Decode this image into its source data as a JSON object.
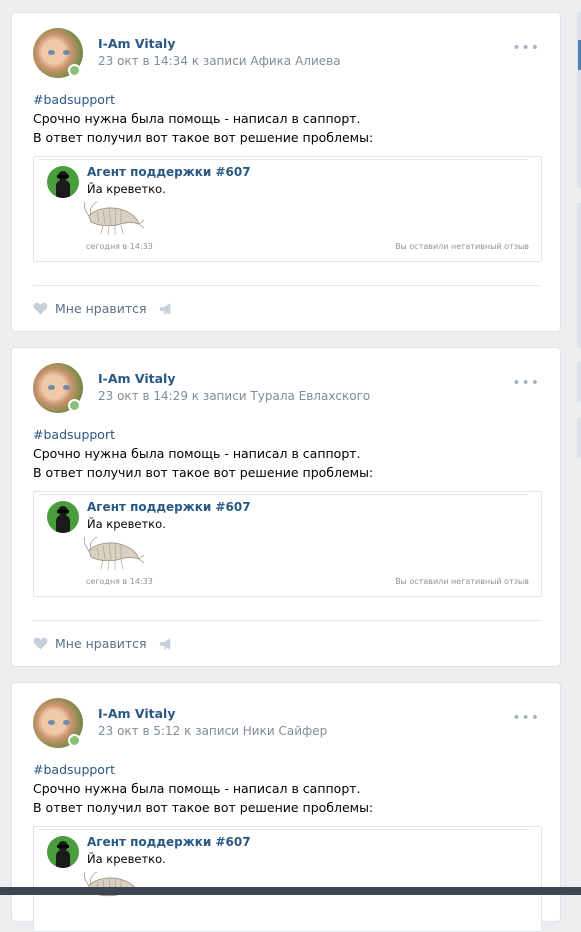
{
  "colors": {
    "link": "#2a5885",
    "meta": "#818c99",
    "online": "#8ac176",
    "agent_avatar_bg": "#4a9d3d",
    "page_bg": "#edeef0"
  },
  "posts": [
    {
      "author": "I-Am Vitaly",
      "date": "23 окт в 14:34 к записи Афика Алиева",
      "tag": "#badsupport",
      "line1": "Срочно нужна была помощь - написал в саппорт.",
      "line2": "В ответ получил вот такое вот решение проблемы:",
      "embed": {
        "agent": "Агент поддержки #607",
        "message": "Йа креветко.",
        "time": "сегодня в 14:33",
        "status": "Вы оставили негативный отзыв"
      },
      "like_label": "Мне нравится"
    },
    {
      "author": "I-Am Vitaly",
      "date": "23 окт в 14:29 к записи Турала Евлахского",
      "tag": "#badsupport",
      "line1": "Срочно нужна была помощь - написал в саппорт.",
      "line2": "В ответ получил вот такое вот решение проблемы:",
      "embed": {
        "agent": "Агент поддержки #607",
        "message": "Йа креветко.",
        "time": "сегодня в 14:33",
        "status": "Вы оставили негативный отзыв"
      },
      "like_label": "Мне нравится"
    },
    {
      "author": "I-Am Vitaly",
      "date": "23 окт в 5:12 к записи Ники Сайфер",
      "tag": "#badsupport",
      "line1": "Срочно нужна была помощь - написал в саппорт.",
      "line2": "В ответ получил вот такое вот решение проблемы:",
      "embed": {
        "agent": "Агент поддержки #607",
        "message": "Йа креветко."
      },
      "like_label": ""
    }
  ],
  "icons": {
    "more": "more-dots-icon",
    "like": "heart-icon",
    "share": "megaphone-icon"
  }
}
